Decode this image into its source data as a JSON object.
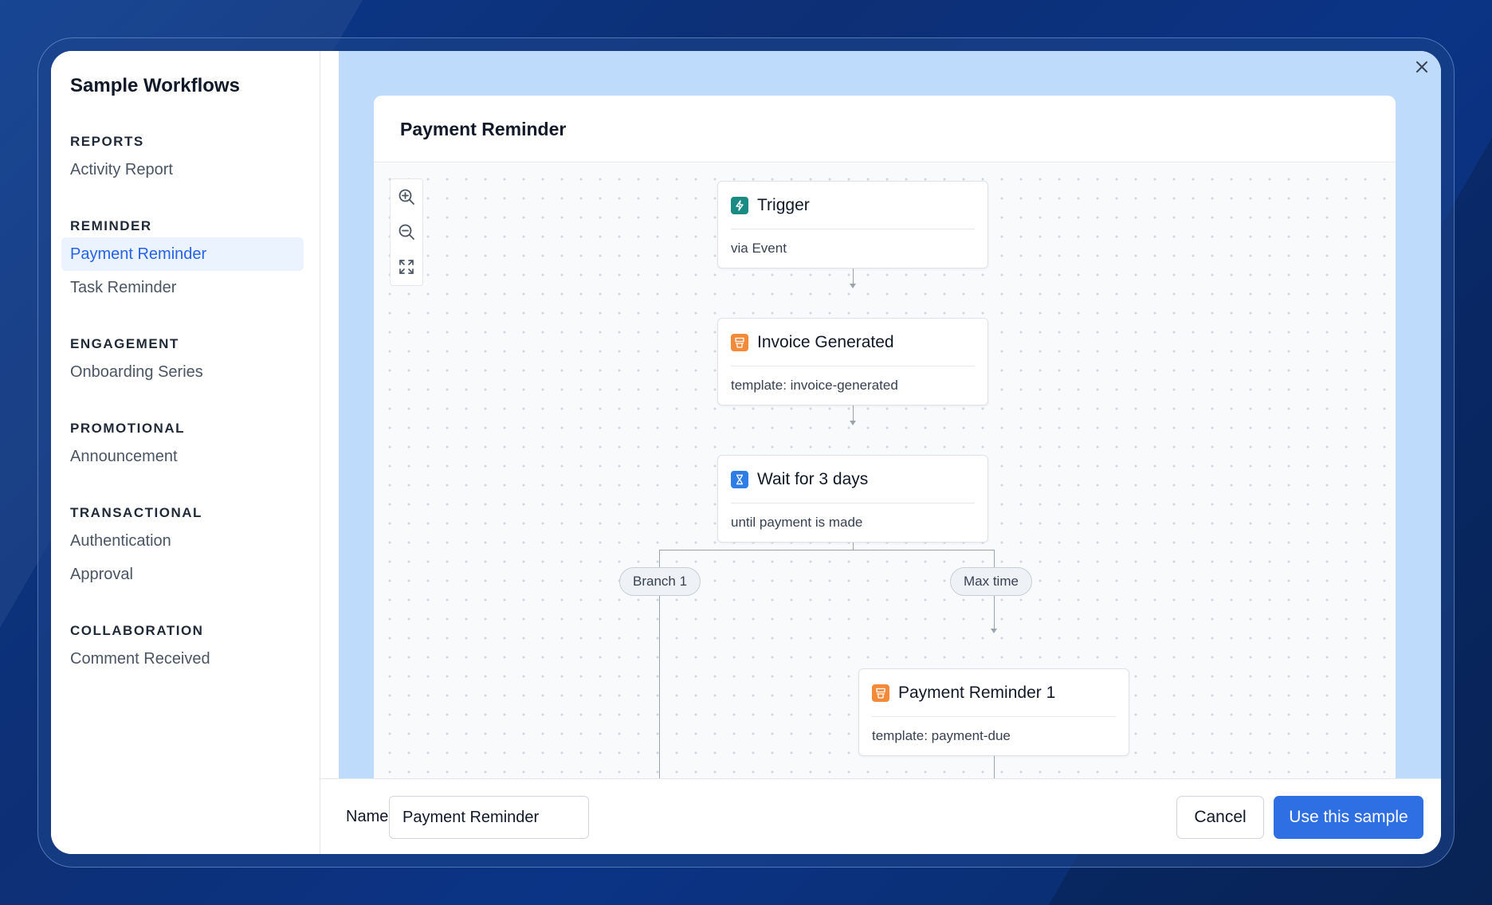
{
  "sidebar": {
    "title": "Sample Workflows",
    "sections": [
      {
        "heading": "REPORTS",
        "items": [
          "Activity Report"
        ]
      },
      {
        "heading": "REMINDER",
        "items": [
          "Payment Reminder",
          "Task Reminder"
        ]
      },
      {
        "heading": "ENGAGEMENT",
        "items": [
          "Onboarding Series"
        ]
      },
      {
        "heading": "PROMOTIONAL",
        "items": [
          "Announcement"
        ]
      },
      {
        "heading": "TRANSACTIONAL",
        "items": [
          "Authentication",
          "Approval"
        ]
      },
      {
        "heading": "COLLABORATION",
        "items": [
          "Comment Received"
        ]
      }
    ],
    "active_item": "Payment Reminder"
  },
  "main": {
    "close_icon": "close-icon",
    "card_title": "Payment Reminder",
    "zoom_controls": [
      "zoom-in-icon",
      "zoom-out-icon",
      "fit-view-icon"
    ],
    "nodes": {
      "trigger": {
        "title": "Trigger",
        "subtitle": "via Event",
        "icon": "bolt-icon",
        "color": "#1a8a84"
      },
      "invoice": {
        "title": "Invoice Generated",
        "subtitle": "template: invoice-generated",
        "icon": "email-template-icon",
        "color": "#f28a3a"
      },
      "wait": {
        "title": "Wait for 3 days",
        "subtitle": "until payment is made",
        "icon": "hourglass-icon",
        "color": "#2f7ee6"
      },
      "reminder1": {
        "title": "Payment Reminder 1",
        "subtitle": "template: payment-due",
        "icon": "email-template-icon",
        "color": "#f28a3a"
      }
    },
    "branches": {
      "left": "Branch 1",
      "right": "Max time"
    }
  },
  "footer": {
    "name_label": "Name",
    "name_value": "Payment Reminder",
    "cancel_label": "Cancel",
    "primary_label": "Use this sample"
  },
  "colors": {
    "accent": "#2f6fe4",
    "active_bg": "#eaf3ff",
    "canvas_bg": "#bfdbfb"
  }
}
